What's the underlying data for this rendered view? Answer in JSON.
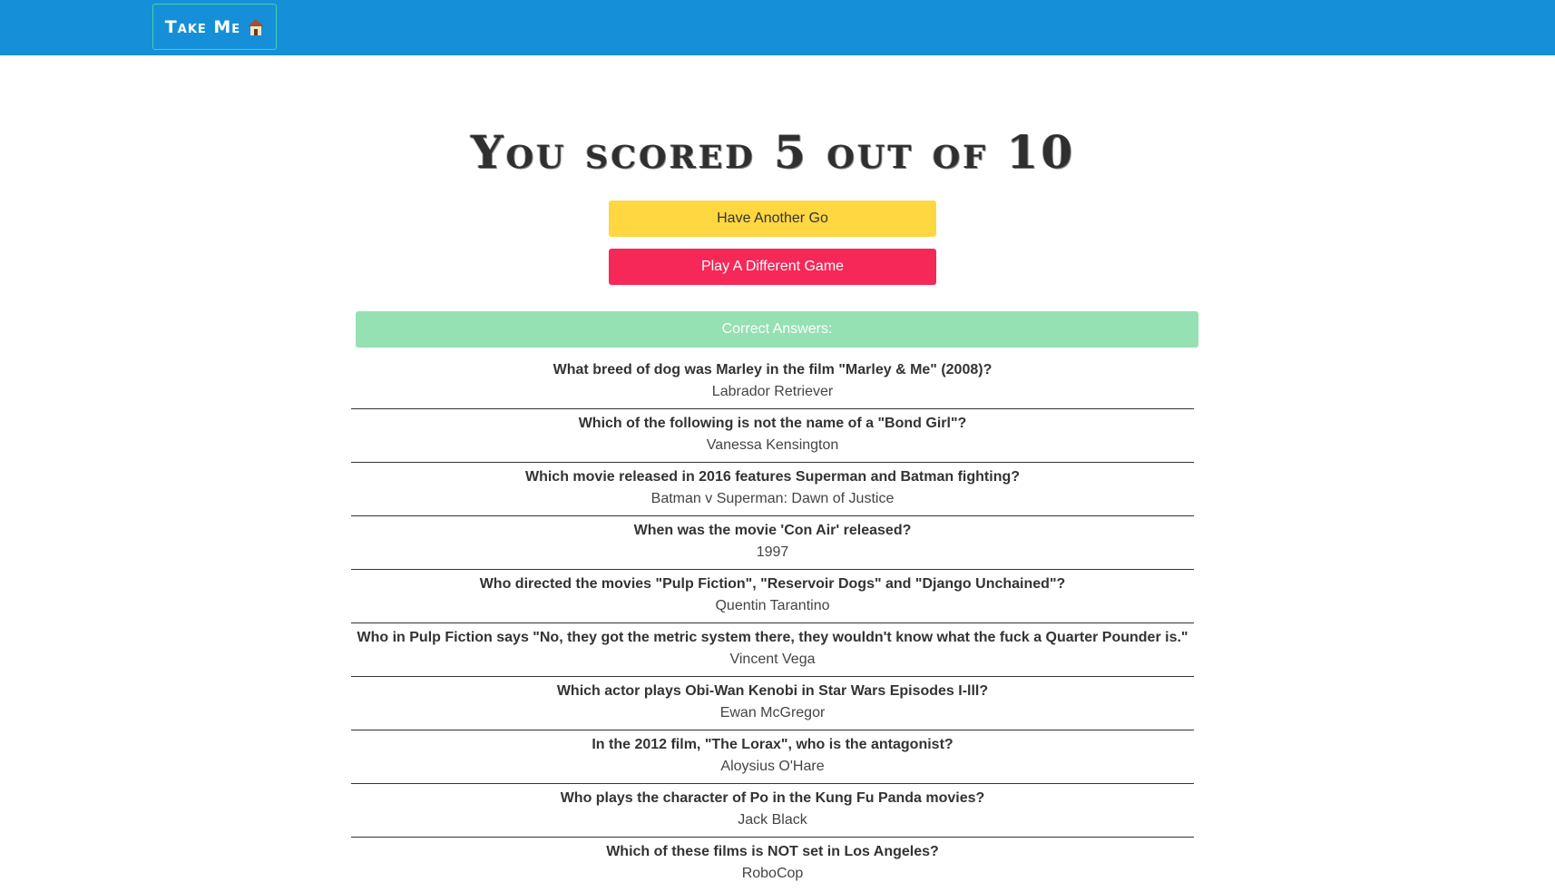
{
  "nav": {
    "home_label": "Take Me",
    "home_icon": "house-icon"
  },
  "result": {
    "title": "You scored 5 out of 10"
  },
  "actions": {
    "again_label": "Have Another Go",
    "different_label": "Play A Different Game"
  },
  "answers": {
    "header": "Correct Answers:",
    "items": [
      {
        "question": "What breed of dog was Marley in the film \"Marley & Me\" (2008)?",
        "answer": "Labrador Retriever"
      },
      {
        "question": "Which of the following is not the name of a \"Bond Girl\"?",
        "answer": "Vanessa Kensington"
      },
      {
        "question": "Which movie released in 2016 features Superman and Batman fighting?",
        "answer": "Batman v Superman: Dawn of Justice"
      },
      {
        "question": "When was the movie 'Con Air' released?",
        "answer": "1997"
      },
      {
        "question": "Who directed the movies \"Pulp Fiction\", \"Reservoir Dogs\" and \"Django Unchained\"?",
        "answer": "Quentin Tarantino"
      },
      {
        "question": "Who in Pulp Fiction says \"No, they got the metric system there, they wouldn't know what the fuck a Quarter Pounder is.\"",
        "answer": "Vincent Vega"
      },
      {
        "question": "Which actor plays Obi-Wan Kenobi in Star Wars Episodes I-lll?",
        "answer": "Ewan McGregor"
      },
      {
        "question": "In the 2012 film, \"The Lorax\", who is the antagonist?",
        "answer": "Aloysius O'Hare"
      },
      {
        "question": "Who plays the character of Po in the Kung Fu Panda movies?",
        "answer": "Jack Black"
      },
      {
        "question": "Which of these films is NOT set in Los Angeles?",
        "answer": "RoboCop"
      }
    ]
  },
  "colors": {
    "nav_bg": "#1590d8",
    "again_bg": "#ffd740",
    "different_bg": "#f62858",
    "answers_header_bg": "#95e1b3"
  }
}
